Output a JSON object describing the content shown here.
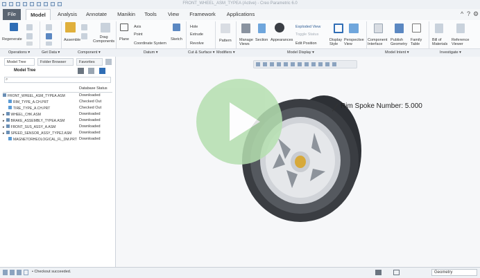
{
  "window": {
    "title": "FRONT_WHEEL_ASM_TYPEA (Active) - Creo Parametric 6.0",
    "controls": [
      "^",
      "?",
      "⚙"
    ]
  },
  "menu": {
    "tabs": [
      "File",
      "Model",
      "Analysis",
      "Annotate",
      "Manikin",
      "Tools",
      "View",
      "Framework",
      "Applications"
    ]
  },
  "ribbon": {
    "operations": {
      "regenerate": "Regenerate"
    },
    "component": {
      "assemble": "Assemble",
      "drag": "Drag\nComponents"
    },
    "datum": {
      "plane": "Plane",
      "axis": "Axis",
      "point": "Point",
      "coordinate_system": "Coordinate System",
      "sketch": "Sketch"
    },
    "cut_surface": {
      "hole": "Hole",
      "extrude": "Extrude",
      "revolve": "Revolve"
    },
    "modifiers": {
      "pattern": "Pattern"
    },
    "model_display": {
      "manage_views": "Manage\nViews",
      "section": "Section",
      "appearances": "Appearances",
      "exploded_view": "Exploded View",
      "toggle_status": "Toggle Status",
      "edit_position": "Edit Position",
      "display_style": "Display\nStyle",
      "perspective_view": "Perspective\nView"
    },
    "model_intent": {
      "component_interface": "Component\nInterface",
      "publish_geometry": "Publish\nGeometry",
      "family_table": "Family\nTable"
    },
    "investigate": {
      "bill_of_materials": "Bill of\nMaterials",
      "reference_viewer": "Reference\nViewer"
    },
    "groups": [
      "Operations ▾",
      "Get Data ▾",
      "Component ▾",
      "Datum ▾",
      "Cut & Surface ▾",
      "Modifiers ▾",
      "Model Display ▾",
      "Model Intent ▾",
      "Investigate ▾"
    ]
  },
  "panel": {
    "tabs": [
      "Model Tree",
      "Folder Browser",
      "Favorites"
    ],
    "title": "Model Tree",
    "column_header": "Database Status",
    "rows": [
      {
        "name": "FRONT_WHEEL_ASM_TYPEA.ASM",
        "status": "Downloaded"
      },
      {
        "name": "RIM_TYPE_A.CH.PRT",
        "status": "Checked Out"
      },
      {
        "name": "TIRE_TYPE_A.CH.PRT",
        "status": "Checked Out"
      },
      {
        "name": "WHEEL_CHK.ASM",
        "status": "Downloaded"
      },
      {
        "name": "BRAKE_ASSEMBLY_TYPEA.ASM",
        "status": "Downloaded"
      },
      {
        "name": "FRONT_SUS_ASSY_A.ASM",
        "status": "Downloaded"
      },
      {
        "name": "SPEED_SENSOR_ASSY_TYPE2.ASM",
        "status": "Downloaded"
      },
      {
        "name": "MAGNETORHEOLOGICAL_FL_DM.PRT",
        "status": "Downloaded"
      }
    ]
  },
  "viewport": {
    "annotation": "Rim Spoke Number: 5.000"
  },
  "status": {
    "message": "• Checkout succeeded.",
    "filter": "Geometry"
  },
  "colors": {
    "play_overlay": "#b5dfb0",
    "file_tab": "#5a6572",
    "tire": "#3a3d42",
    "hub": "#d7a93a"
  },
  "icons": [
    "play-icon",
    "search-icon",
    "regenerate-icon",
    "assemble-icon"
  ]
}
